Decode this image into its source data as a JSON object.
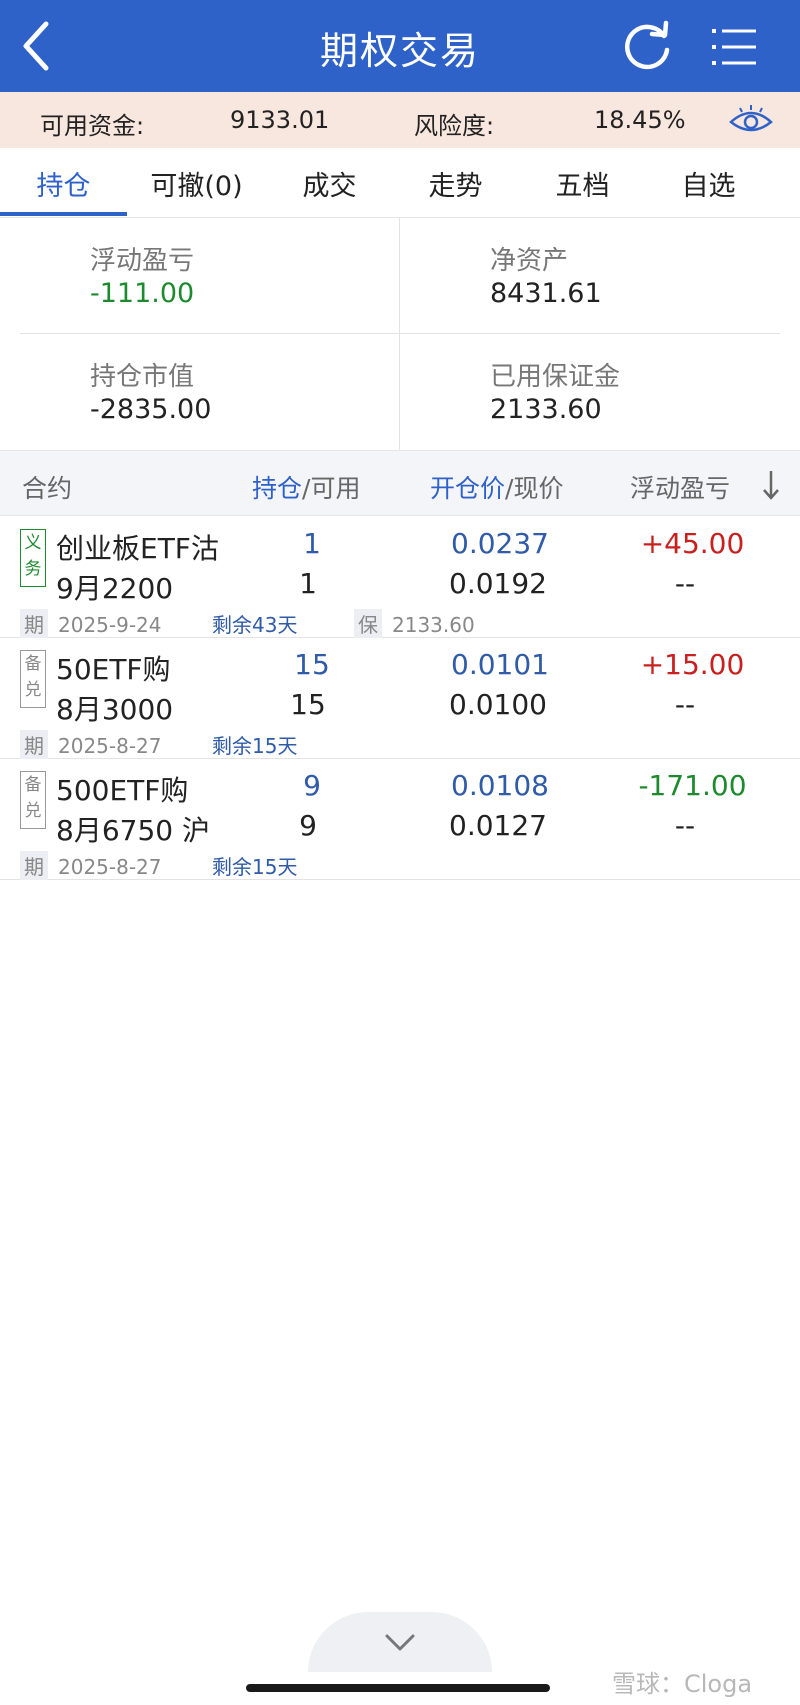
{
  "header": {
    "title": "期权交易",
    "back_icon": "back-chevron-icon",
    "refresh_icon": "refresh-icon",
    "menu_icon": "menu-list-icon"
  },
  "info_bar": {
    "available_funds_label": "可用资金:",
    "available_funds_value": "9133.01",
    "risk_label": "风险度:",
    "risk_value": "18.45%",
    "eye_icon": "eye-icon"
  },
  "tabs": [
    {
      "label": "持仓",
      "active": true
    },
    {
      "label": "可撤(0)"
    },
    {
      "label": "成交"
    },
    {
      "label": "走势"
    },
    {
      "label": "五档"
    },
    {
      "label": "自选"
    }
  ],
  "summary": {
    "floating_pnl_label": "浮动盈亏",
    "floating_pnl_value": "-111.00",
    "net_assets_label": "净资产",
    "net_assets_value": "8431.61",
    "position_value_label": "持仓市值",
    "position_value_value": "-2835.00",
    "margin_used_label": "已用保证金",
    "margin_used_value": "2133.60"
  },
  "table": {
    "col_contract": "合约",
    "col_position_a": "持仓",
    "col_position_b": "/可用",
    "col_price_a": "开仓价",
    "col_price_b": "/现价",
    "col_pnl": "浮动盈亏",
    "rows": [
      {
        "badge": "义务",
        "name": "创业板ETF沽",
        "month": "9月2200",
        "position": "1",
        "available": "1",
        "open_price": "0.0237",
        "current_price": "0.0192",
        "pnl": "+45.00",
        "pnl_sub": "--",
        "expiry_tag": "期",
        "expiry": "2025-9-24",
        "remaining": "剩余43天",
        "margin_tag": "保",
        "margin": "2133.60"
      },
      {
        "badge": "备兑",
        "name": "50ETF购",
        "month": "8月3000",
        "position": "15",
        "available": "15",
        "open_price": "0.0101",
        "current_price": "0.0100",
        "pnl": "+15.00",
        "pnl_sub": "--",
        "expiry_tag": "期",
        "expiry": "2025-8-27",
        "remaining": "剩余15天"
      },
      {
        "badge": "备兑",
        "name": "500ETF购",
        "month": "8月6750 沪",
        "position": "9",
        "available": "9",
        "open_price": "0.0108",
        "current_price": "0.0127",
        "pnl": "-171.00",
        "pnl_sub": "--",
        "expiry_tag": "期",
        "expiry": "2025-8-27",
        "remaining": "剩余15天"
      }
    ]
  },
  "footer": {
    "watermark": "雪球：Cloga"
  }
}
